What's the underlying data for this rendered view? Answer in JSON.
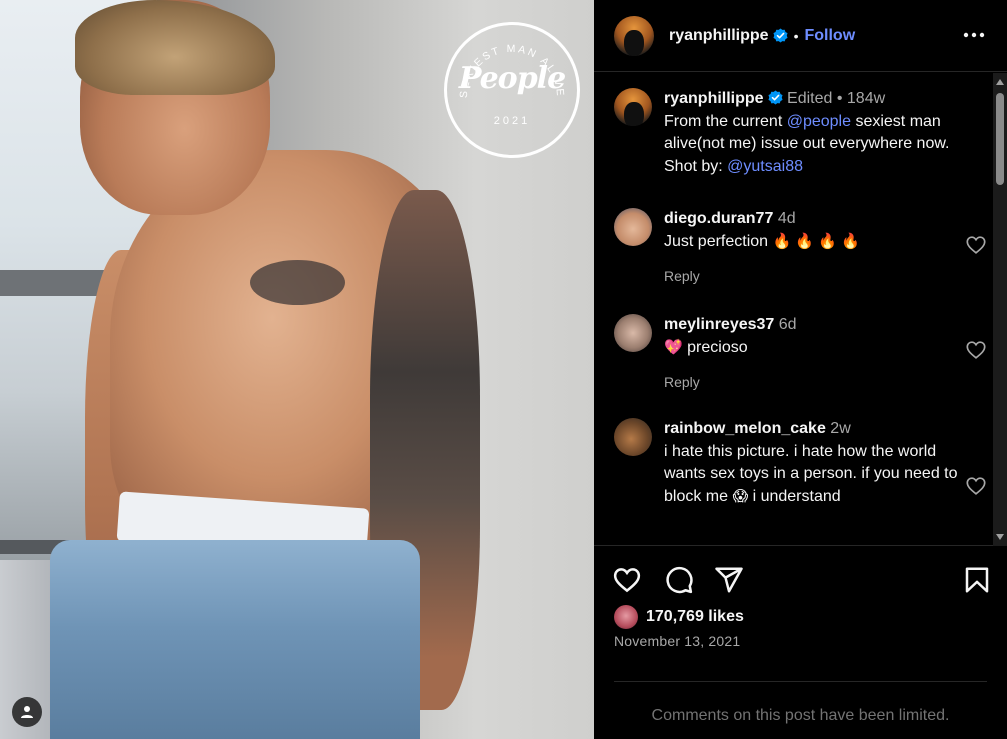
{
  "post": {
    "username": "ryanphillippe",
    "follow_label": "Follow",
    "badge": {
      "arc_text": "SEXIEST MAN ALIVE",
      "logo": "People",
      "year": "2021"
    }
  },
  "caption": {
    "username": "ryanphillippe",
    "edited_label": "Edited",
    "age": "184w",
    "text_1": "From the current ",
    "mention_1": "@people",
    "text_2": " sexiest man alive(not me) issue out everywhere now. Shot by: ",
    "mention_2": "@yutsai88"
  },
  "comments": [
    {
      "username": "diego.duran77",
      "age": "4d",
      "text": "Just perfection",
      "emoji": "🔥 🔥 🔥 🔥",
      "reply_label": "Reply"
    },
    {
      "username": "meylinreyes37",
      "age": "6d",
      "emoji": "💖",
      "text": "precioso",
      "reply_label": "Reply"
    },
    {
      "username": "rainbow_melon_cake",
      "age": "2w",
      "text": "i hate this picture. i hate how the world wants sex toys in a person. if you need to block me",
      "emoji": "😱",
      "text_2": " i understand"
    }
  ],
  "engagement": {
    "likes": "170,769 likes",
    "date": "November 13, 2021",
    "comments_limited": "Comments on this post have been limited."
  },
  "icons": {
    "verified": "verified-badge-icon",
    "more": "more-options-icon",
    "heart": "heart-icon",
    "comment": "comment-icon",
    "share": "share-icon",
    "save": "bookmark-icon",
    "user_tag": "user-tag-icon"
  },
  "colors": {
    "background": "#000000",
    "link": "#6e8dff",
    "verified": "#0095f6",
    "muted": "#a8a8a8",
    "divider": "#262626"
  }
}
